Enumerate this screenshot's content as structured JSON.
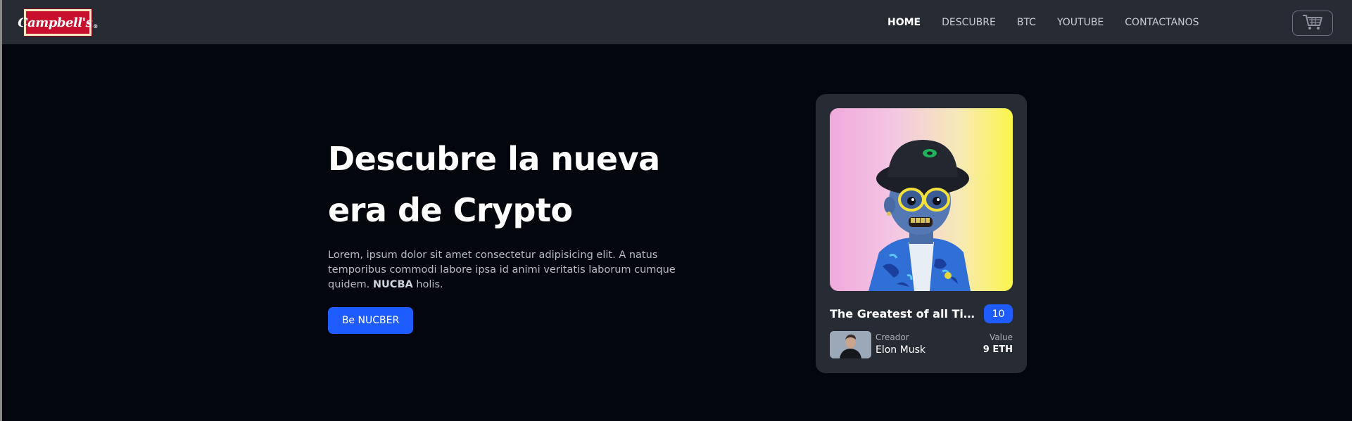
{
  "header": {
    "logo_text": "Campbell's",
    "nav": [
      {
        "label": "HOME",
        "active": true
      },
      {
        "label": "DESCUBRE",
        "active": false
      },
      {
        "label": "BTC",
        "active": false
      },
      {
        "label": "YOUTUBE",
        "active": false
      },
      {
        "label": "CONTACTANOS",
        "active": false
      }
    ],
    "cart_icon": "cart-icon"
  },
  "hero": {
    "title_line1": "Descubre la nueva",
    "title_line2": "era de Crypto",
    "text_before": "Lorem, ipsum dolor sit amet consectetur adipisicing elit. A natus temporibus commodi labore ipsa id animi veritatis laborum cumque quidem. ",
    "text_bold": "NUCBA",
    "text_after": " holis.",
    "cta_label": "Be NUCBER"
  },
  "card": {
    "title": "The Greatest of all Time ...",
    "badge": "10",
    "creator_label": "Creador",
    "creator_name": "Elon Musk",
    "value_label": "Value",
    "value_amount": "9 ETH"
  },
  "colors": {
    "accent": "#1f5cff",
    "nav_bg": "#272c34",
    "page_bg": "#04060d"
  }
}
